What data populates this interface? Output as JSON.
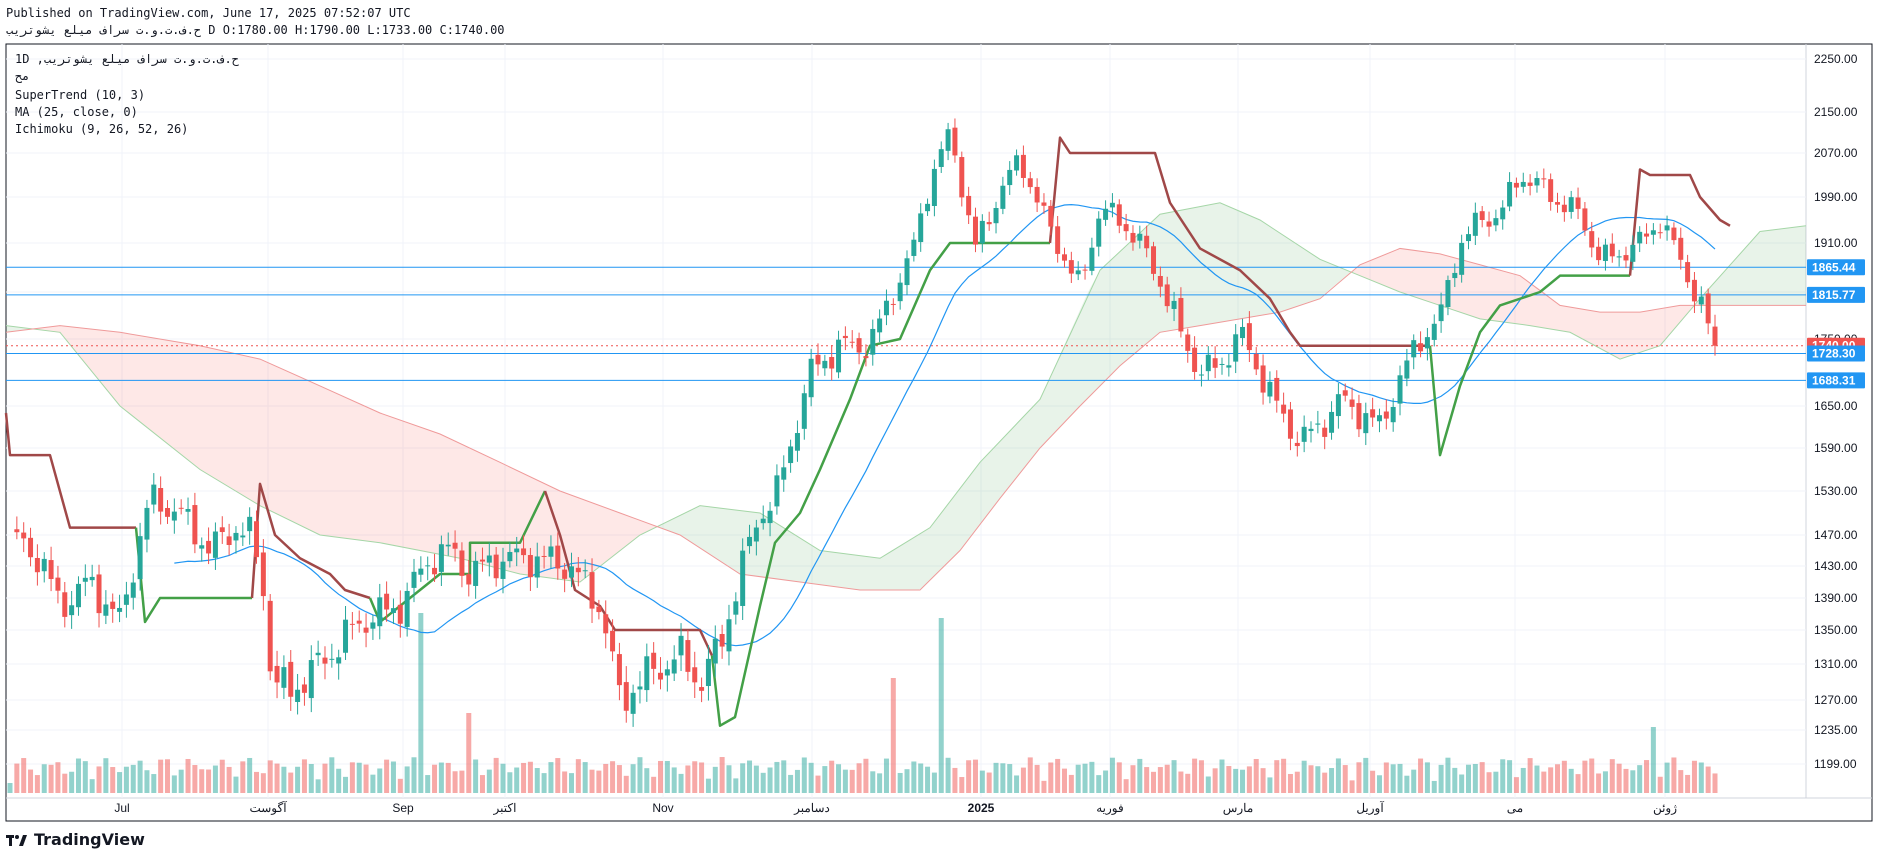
{
  "header": {
    "published": "Published on TradingView.com, June 17, 2025 07:52:07 UTC",
    "ohlc_line": "ح.ف.ت.و.ت سراف ميلع يشوتريب D O:1780.00 H:1790.00 L:1733.00 C:1740.00"
  },
  "legend": {
    "symbol_line": "1D ,ح.ف.ت.و.ت سراف ميلع يشوتريب",
    "exchange": "مح",
    "indicator1": "SuperTrend (10, 3)",
    "indicator2": "MA (25, close, 0)",
    "indicator3": "Ichimoku (9, 26, 52, 26)"
  },
  "brand": {
    "name": "TradingView"
  },
  "colors": {
    "up": "#26a69a",
    "down": "#ef5350",
    "supertrend_up": "#43a047",
    "supertrend_down": "#a04848",
    "ma": "#2196f3",
    "hline": "#2196f3",
    "current": "#ef5350"
  },
  "chart_data": {
    "type": "candlestick",
    "y_ticks": [
      2250,
      2150,
      2070,
      1990,
      1910,
      1820,
      1750,
      1650,
      1590,
      1530,
      1470,
      1430,
      1390,
      1350,
      1310,
      1270,
      1235,
      1199
    ],
    "x_ticks": [
      "Jul",
      "آگوست",
      "Sep",
      "اکتبر",
      "Nov",
      "دسامبر",
      "2025",
      "فوریه",
      "مارس",
      "آوریل",
      "می",
      "ژوئن"
    ],
    "price_labels": [
      {
        "value": 1865.44,
        "label": "1865.44",
        "color": "#2196f3"
      },
      {
        "value": 1815.77,
        "label": "1815.77",
        "color": "#2196f3"
      },
      {
        "value": 1740.0,
        "label": "1740.00",
        "color": "#ef5350"
      },
      {
        "value": 1728.3,
        "label": "1728.30",
        "color": "#2196f3"
      },
      {
        "value": 1688.31,
        "label": "1688.31",
        "color": "#2196f3"
      }
    ],
    "last": {
      "open": 1780.0,
      "high": 1790.0,
      "low": 1733.0,
      "close": 1740.0
    }
  }
}
